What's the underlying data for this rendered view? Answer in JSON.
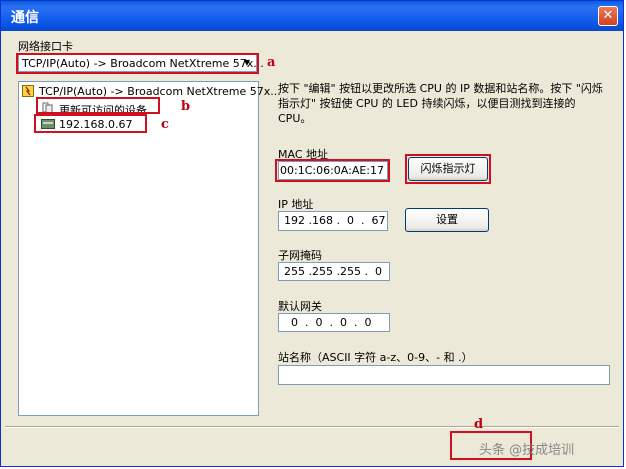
{
  "window": {
    "title": "通信"
  },
  "interface": {
    "label": "网络接口卡",
    "selected": "TCP/IP(Auto) -> Broadcom NetXtreme 57x..."
  },
  "tree": {
    "root_label": "TCP/IP(Auto) -> Broadcom NetXtreme 57x...",
    "refresh_label": "更新可访问的设备",
    "device_label": "192.168.0.67"
  },
  "description": "按下 \"编辑\" 按钮以更改所选 CPU 的 IP 数据和站名称。按下 \"闪烁指示灯\" 按钮使 CPU 的 LED 持续闪烁，以便目测找到连接的 CPU。",
  "mac": {
    "label": "MAC 地址",
    "value": "00:1C:06:0A:AE:17",
    "blink_button": "闪烁指示灯"
  },
  "ip": {
    "label": "IP 地址",
    "value": "192 .168 .  0  .  67",
    "set_button": "设置"
  },
  "subnet": {
    "label": "子网掩码",
    "value": "255 .255 .255 .  0"
  },
  "gateway": {
    "label": "默认网关",
    "value": "  0  .  0  .  0  .  0"
  },
  "station": {
    "label": "站名称（ASCII 字符 a-z、0-9、- 和 .）",
    "value": ""
  },
  "annotations": {
    "a": "a",
    "b": "b",
    "c": "c",
    "d": "d"
  },
  "watermark": "头条 @技成培训",
  "colors": {
    "title_bar": "#0a5fe0",
    "dialog_bg": "#ece9d8",
    "highlight_box": "#d01020"
  }
}
